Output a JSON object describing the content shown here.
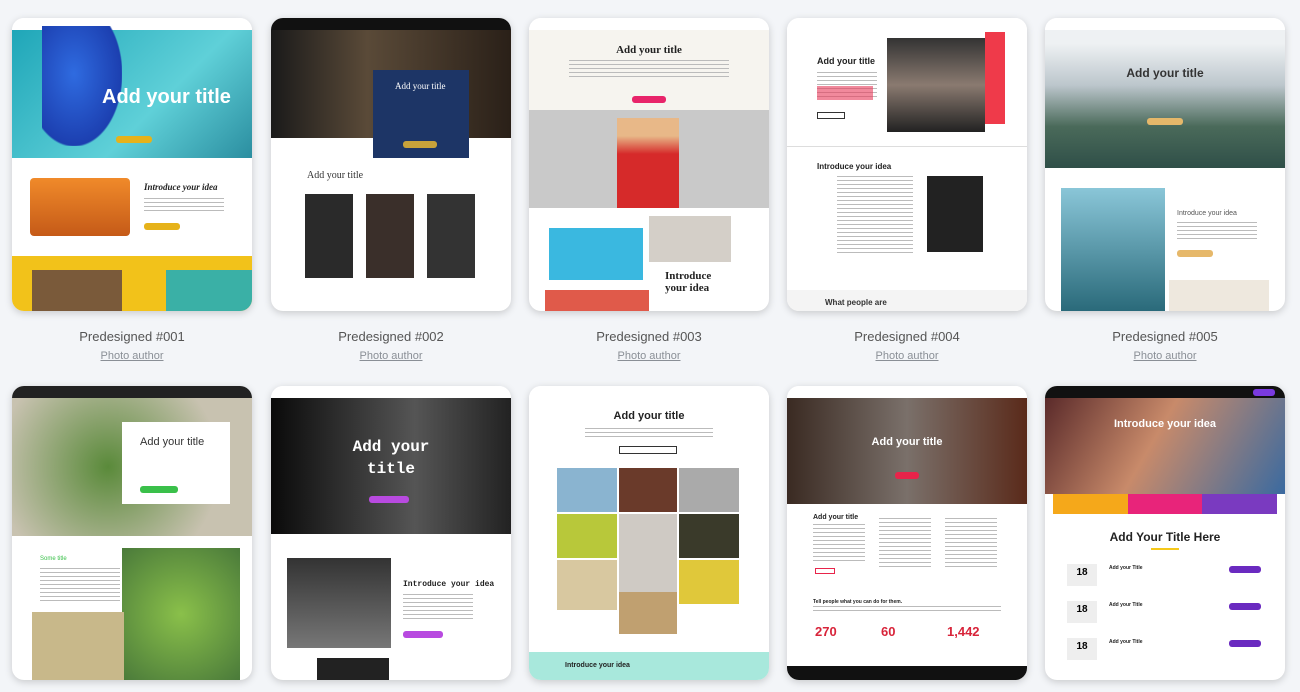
{
  "templates": [
    {
      "title": "Predesigned #001",
      "author": "Photo author",
      "hero_title": "Add your title",
      "section_title": "Introduce your idea"
    },
    {
      "title": "Predesigned #002",
      "author": "Photo author",
      "hero_title": "Add your title",
      "section_title": "Add your title"
    },
    {
      "title": "Predesigned #003",
      "author": "Photo author",
      "hero_title": "Add your title",
      "section_title": "Introduce your idea"
    },
    {
      "title": "Predesigned #004",
      "author": "Photo author",
      "hero_title": "Add your title",
      "section_title": "Introduce your idea",
      "footer_title": "What people are"
    },
    {
      "title": "Predesigned #005",
      "author": "Photo author",
      "hero_title": "Add your title",
      "section_title": "Introduce your idea"
    },
    {
      "hero_title": "Add your title",
      "section_title": "Some title"
    },
    {
      "hero_title": "Add your title",
      "section_title": "Introduce your idea"
    },
    {
      "hero_title": "Add your title",
      "section_title": "Introduce your idea"
    },
    {
      "hero_title": "Add your title",
      "section_title": "Add your title",
      "stats": [
        "270",
        "60",
        "1,442"
      ],
      "tagline": "Tell people what you can do for them."
    },
    {
      "hero_title": "Introduce your idea",
      "section_title": "Add Your Title Here",
      "date": "18",
      "item_title": "Add your Title"
    }
  ],
  "colors": {
    "background": "#f3f5f8",
    "caption": "#555555",
    "author_link": "#8a8f96"
  }
}
